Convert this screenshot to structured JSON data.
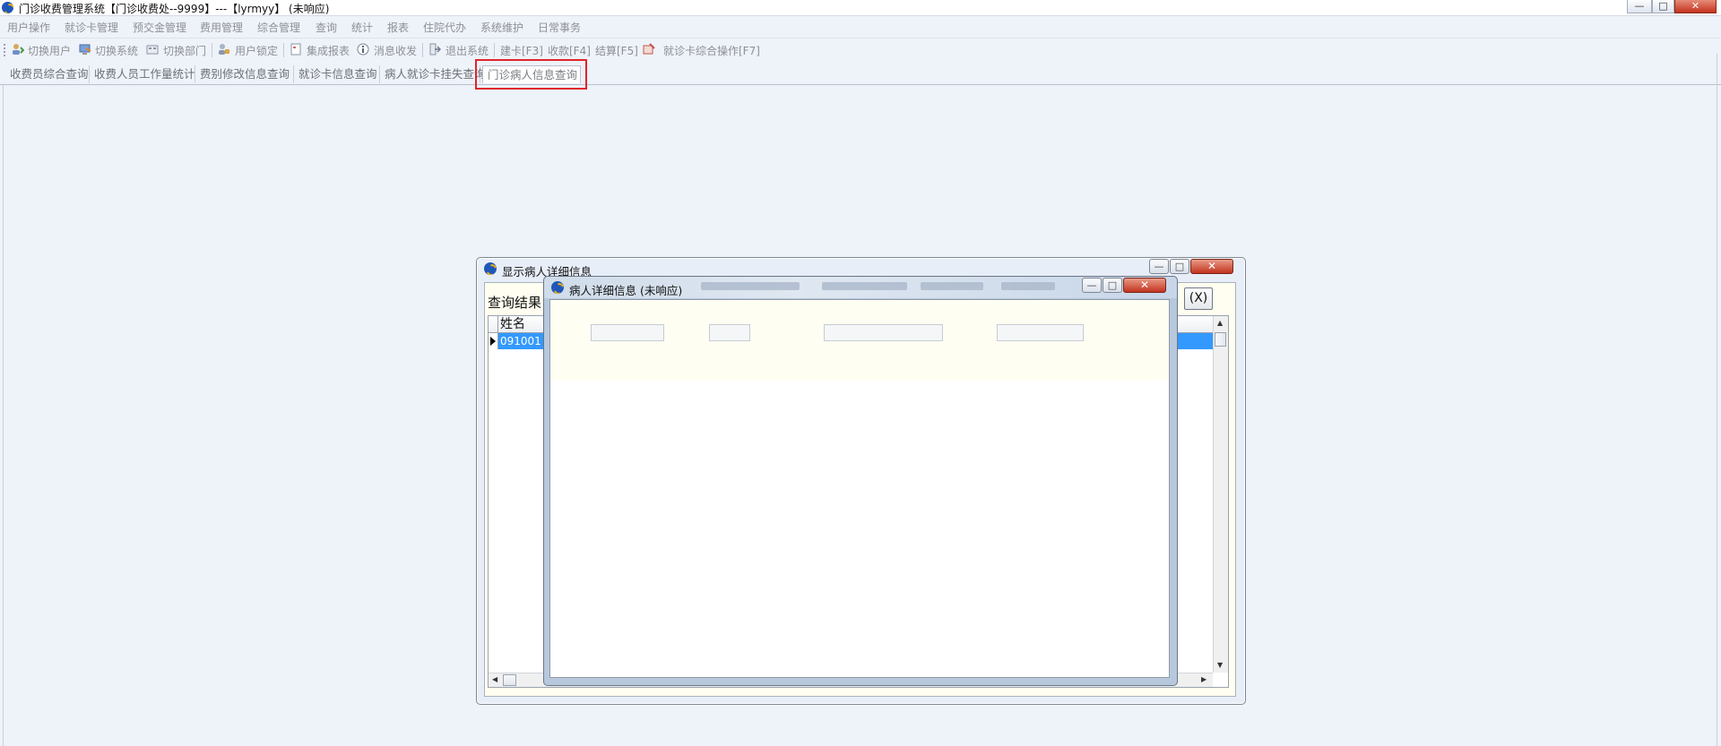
{
  "app": {
    "title": "门诊收费管理系统【门诊收费处--9999】---【lyrmyy】 (未响应)",
    "window_buttons": {
      "minimize": "—",
      "maximize": "□",
      "close": "✕"
    }
  },
  "menubar": {
    "items": [
      "用户操作",
      "就诊卡管理",
      "预交金管理",
      "费用管理",
      "综合管理",
      "查询",
      "统计",
      "报表",
      "住院代办",
      "系统维护",
      "日常事务"
    ]
  },
  "toolbar": {
    "items": [
      {
        "label": "切换用户",
        "icon": "switch-user-icon"
      },
      {
        "label": "切换系统",
        "icon": "switch-system-icon"
      },
      {
        "label": "切换部门",
        "icon": "switch-department-icon"
      },
      {
        "label": "用户锁定",
        "icon": "user-lock-icon"
      },
      {
        "label": "集成报表",
        "icon": "integrated-report-icon"
      },
      {
        "label": "消息收发",
        "icon": "message-icon"
      },
      {
        "label": "退出系统",
        "icon": "exit-icon"
      },
      {
        "label": "建卡[F3]"
      },
      {
        "label": "收款[F4]"
      },
      {
        "label": "结算[F5]"
      },
      {
        "label": "就诊卡综合操作[F7]",
        "icon": "card-operation-icon"
      }
    ]
  },
  "tabs": [
    {
      "label": "收费员综合查询",
      "active": false
    },
    {
      "label": "收费人员工作量统计",
      "active": false
    },
    {
      "label": "费别修改信息查询",
      "active": false
    },
    {
      "label": "就诊卡信息查询",
      "active": false
    },
    {
      "label": "病人就诊卡挂失查询",
      "active": false
    },
    {
      "label": "门诊病人信息查询",
      "active": true
    }
  ],
  "outer_dialog": {
    "title": "显示病人详细信息",
    "query_label": "查询结果",
    "x_button": "(X)",
    "grid": {
      "columns": [
        "姓名"
      ],
      "right_column_fragment": "",
      "rows": [
        {
          "selected": true,
          "value": "091001"
        }
      ]
    },
    "buttons": {
      "minimize": "—",
      "maximize": "□",
      "close": "✕"
    }
  },
  "inner_dialog": {
    "title": "病人详细信息 (未响应)",
    "buttons": {
      "minimize": "—",
      "maximize": "□",
      "close": "✕"
    },
    "fields": [
      {
        "value": ""
      },
      {
        "value": ""
      },
      {
        "value": ""
      },
      {
        "value": ""
      }
    ]
  },
  "colors": {
    "highlight": "#e0252b",
    "selection": "#3399ff",
    "background": "#eef2f9",
    "dialog_body": "#fffef0"
  }
}
